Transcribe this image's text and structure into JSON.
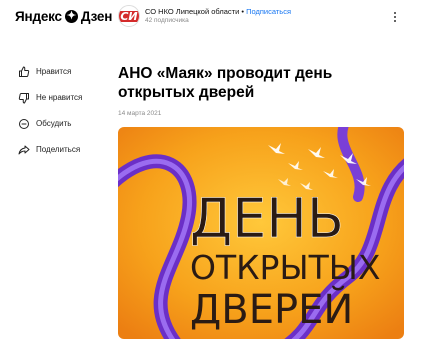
{
  "header": {
    "logo_left": "Яндекс",
    "logo_right": "Дзен",
    "channel_name": "СО НКО Липецкой области",
    "channel_separator": " • ",
    "subscribe": "Подписаться",
    "subscribers": "42 подписчика",
    "avatar_text": "СИ"
  },
  "sidebar": {
    "like": "Нравится",
    "dislike": "Не нравится",
    "comment": "Обсудить",
    "share": "Поделиться"
  },
  "article": {
    "title": "АНО «Маяк» проводит день открытых дверей",
    "date": "14 марта 2021",
    "image_line1": "ДЕНЬ",
    "image_line2": "ОТКРЫТЫХ",
    "image_line3": "ДВЕРЕЙ"
  },
  "colors": {
    "accent_link": "#1877f2",
    "image_orange": "#f7a21b",
    "image_ribbon": "#7a3fd6"
  }
}
